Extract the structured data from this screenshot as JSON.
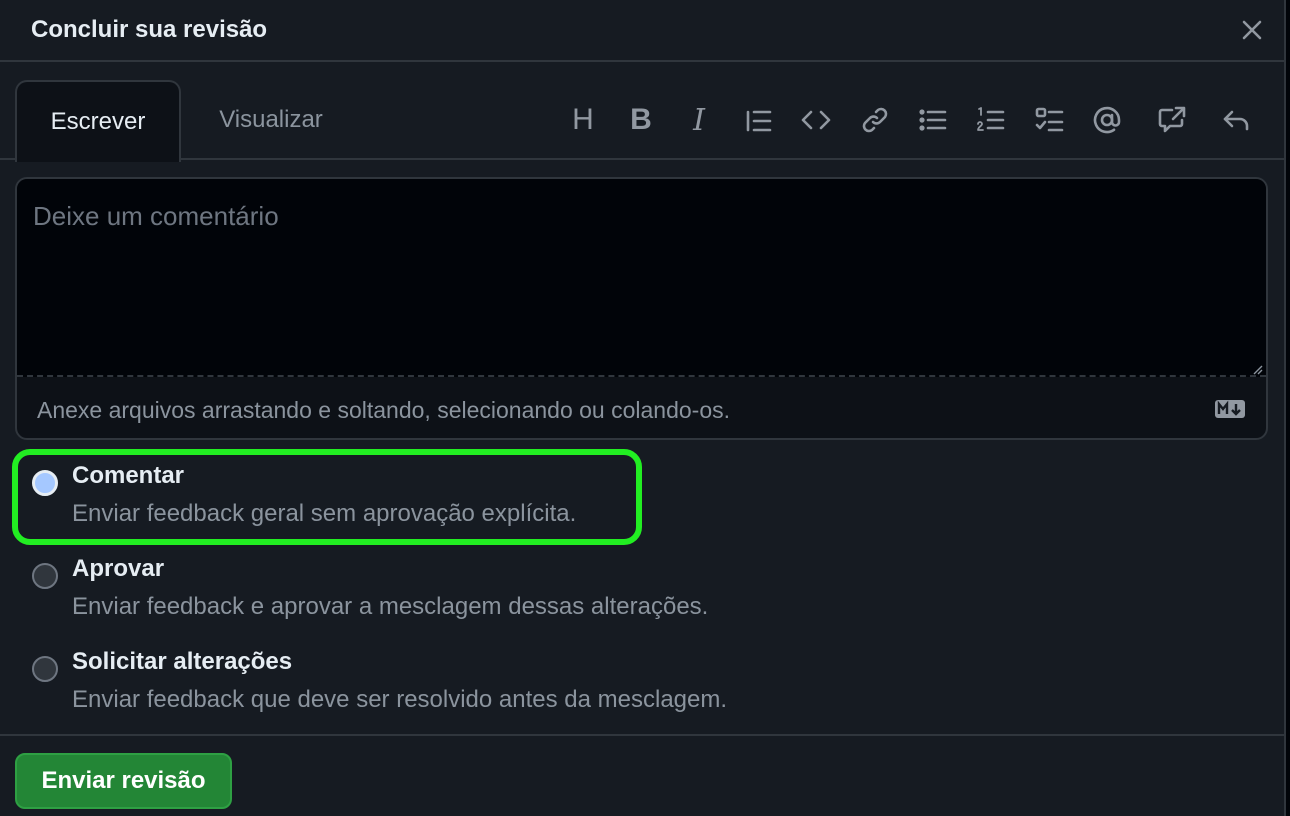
{
  "dialog": {
    "title": "Concluir sua revisão"
  },
  "tabs": [
    {
      "label": "Escrever",
      "active": true
    },
    {
      "label": "Visualizar",
      "active": false
    }
  ],
  "toolbar": {
    "icons": [
      "heading-icon",
      "bold-icon",
      "italic-icon",
      "quote-icon",
      "code-icon",
      "link-icon",
      "bulleted-list-icon",
      "numbered-list-icon",
      "task-list-icon",
      "mention-icon",
      "cross-reference-icon",
      "reply-icon"
    ],
    "heading_glyph": "H",
    "bold_glyph": "B",
    "italic_glyph": "I"
  },
  "editor": {
    "placeholder": "Deixe um comentário",
    "value": "",
    "attach_hint": "Anexe arquivos arrastando e soltando, selecionando ou colando-os."
  },
  "review_options": [
    {
      "label": "Comentar",
      "description": "Enviar feedback geral sem aprovação explícita.",
      "checked": true
    },
    {
      "label": "Aprovar",
      "description": "Enviar feedback e aprovar a mesclagem dessas alterações.",
      "checked": false
    },
    {
      "label": "Solicitar alterações",
      "description": "Enviar feedback que deve ser resolvido antes da mesclagem.",
      "checked": false
    }
  ],
  "footer": {
    "submit_label": "Enviar revisão"
  },
  "colors": {
    "background": "#161b22",
    "primary_button": "#238636",
    "highlight": "#22ee22"
  }
}
